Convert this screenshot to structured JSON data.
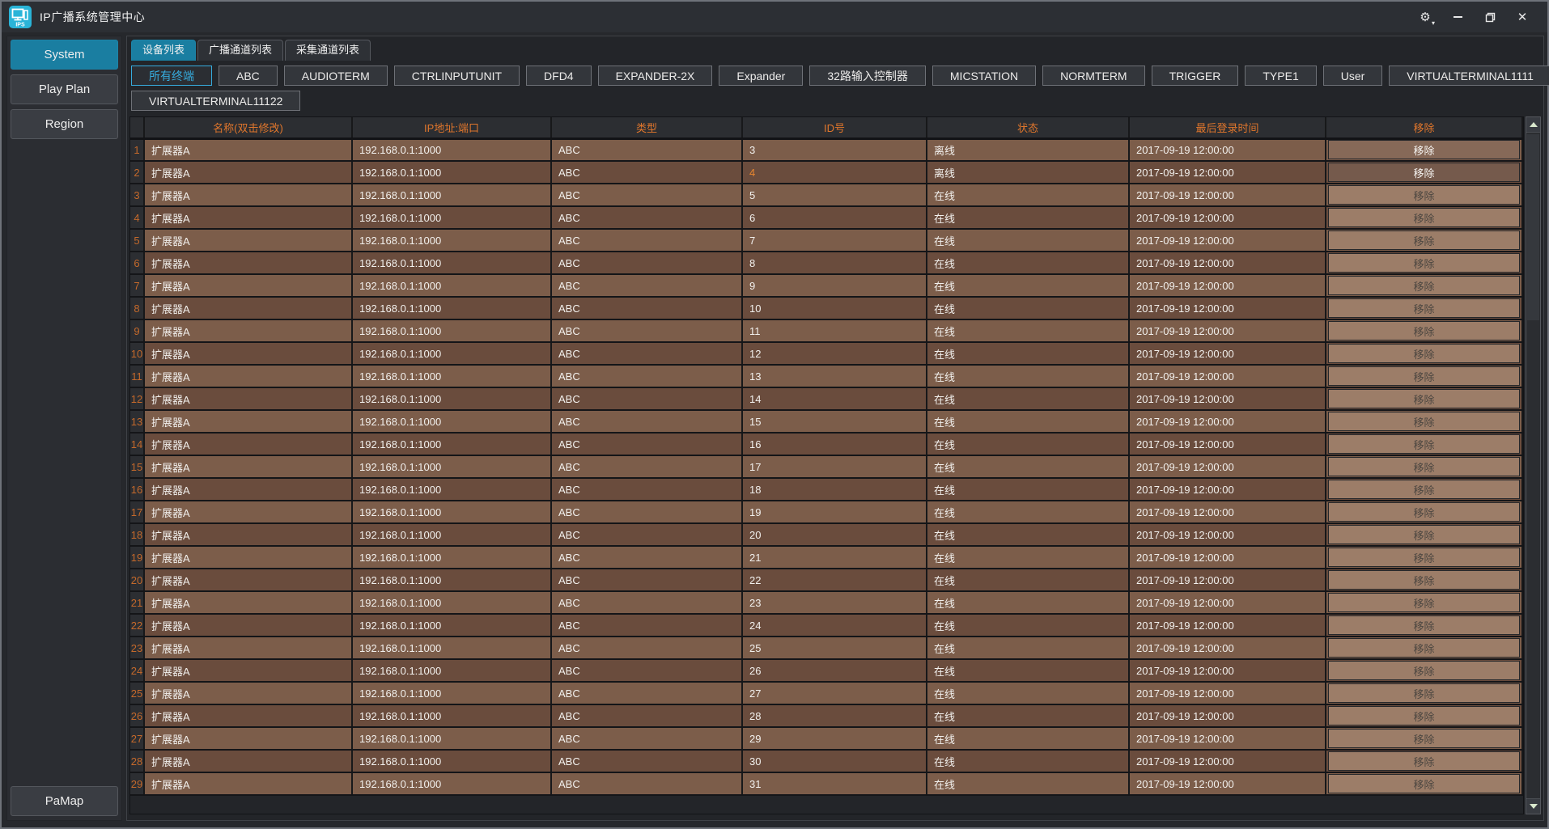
{
  "window": {
    "title": "IP广播系统管理中心",
    "icon_text": "IPS",
    "controls": [
      {
        "name": "settings-gear-icon",
        "glyph": "⚙"
      },
      {
        "name": "minimize-icon",
        "glyph": "–"
      },
      {
        "name": "restore-icon",
        "glyph": "❐"
      },
      {
        "name": "close-icon",
        "glyph": "✕"
      }
    ]
  },
  "sidebar": {
    "items": [
      {
        "label": "System",
        "active": true
      },
      {
        "label": "Play Plan",
        "active": false
      },
      {
        "label": "Region",
        "active": false
      }
    ],
    "bottom_item": {
      "label": "PaMap"
    }
  },
  "tabs": [
    {
      "label": "设备列表",
      "active": true
    },
    {
      "label": "广播通道列表",
      "active": false
    },
    {
      "label": "采集通道列表",
      "active": false
    }
  ],
  "filters": {
    "active": "所有终端",
    "rows": [
      [
        "所有终端",
        "ABC",
        "AUDIOTERM",
        "CTRLINPUTUNIT",
        "DFD4",
        "EXPANDER-2X",
        "Expander",
        "32路输入控制器",
        "MICSTATION",
        "NORMTERM",
        "TRIGGER",
        "TYPE1",
        "User",
        "VIRTUALTERMINAL1111"
      ],
      [
        "VIRTUALTERMINAL11122"
      ]
    ]
  },
  "table": {
    "columns": [
      "名称(双击修改)",
      "IP地址:端口",
      "类型",
      "ID号",
      "状态",
      "最后登录时间",
      "移除"
    ],
    "remove_label": "移除",
    "rows": [
      {
        "num": 1,
        "name": "扩展器A",
        "ip": "192.168.0.1:1000",
        "type": "ABC",
        "id": "3",
        "id_highlighted": false,
        "status": "离线",
        "time": "2017-09-19 12:00:00",
        "removable": true
      },
      {
        "num": 2,
        "name": "扩展器A",
        "ip": "192.168.0.1:1000",
        "type": "ABC",
        "id": "4",
        "id_highlighted": true,
        "status": "离线",
        "time": "2017-09-19 12:00:00",
        "removable": true
      },
      {
        "num": 3,
        "name": "扩展器A",
        "ip": "192.168.0.1:1000",
        "type": "ABC",
        "id": "5",
        "id_highlighted": false,
        "status": "在线",
        "time": "2017-09-19 12:00:00",
        "removable": false
      },
      {
        "num": 4,
        "name": "扩展器A",
        "ip": "192.168.0.1:1000",
        "type": "ABC",
        "id": "6",
        "id_highlighted": false,
        "status": "在线",
        "time": "2017-09-19 12:00:00",
        "removable": false
      },
      {
        "num": 5,
        "name": "扩展器A",
        "ip": "192.168.0.1:1000",
        "type": "ABC",
        "id": "7",
        "id_highlighted": false,
        "status": "在线",
        "time": "2017-09-19 12:00:00",
        "removable": false
      },
      {
        "num": 6,
        "name": "扩展器A",
        "ip": "192.168.0.1:1000",
        "type": "ABC",
        "id": "8",
        "id_highlighted": false,
        "status": "在线",
        "time": "2017-09-19 12:00:00",
        "removable": false
      },
      {
        "num": 7,
        "name": "扩展器A",
        "ip": "192.168.0.1:1000",
        "type": "ABC",
        "id": "9",
        "id_highlighted": false,
        "status": "在线",
        "time": "2017-09-19 12:00:00",
        "removable": false
      },
      {
        "num": 8,
        "name": "扩展器A",
        "ip": "192.168.0.1:1000",
        "type": "ABC",
        "id": "10",
        "id_highlighted": false,
        "status": "在线",
        "time": "2017-09-19 12:00:00",
        "removable": false
      },
      {
        "num": 9,
        "name": "扩展器A",
        "ip": "192.168.0.1:1000",
        "type": "ABC",
        "id": "11",
        "id_highlighted": false,
        "status": "在线",
        "time": "2017-09-19 12:00:00",
        "removable": false
      },
      {
        "num": 10,
        "name": "扩展器A",
        "ip": "192.168.0.1:1000",
        "type": "ABC",
        "id": "12",
        "id_highlighted": false,
        "status": "在线",
        "time": "2017-09-19 12:00:00",
        "removable": false
      },
      {
        "num": 11,
        "name": "扩展器A",
        "ip": "192.168.0.1:1000",
        "type": "ABC",
        "id": "13",
        "id_highlighted": false,
        "status": "在线",
        "time": "2017-09-19 12:00:00",
        "removable": false
      },
      {
        "num": 12,
        "name": "扩展器A",
        "ip": "192.168.0.1:1000",
        "type": "ABC",
        "id": "14",
        "id_highlighted": false,
        "status": "在线",
        "time": "2017-09-19 12:00:00",
        "removable": false
      },
      {
        "num": 13,
        "name": "扩展器A",
        "ip": "192.168.0.1:1000",
        "type": "ABC",
        "id": "15",
        "id_highlighted": false,
        "status": "在线",
        "time": "2017-09-19 12:00:00",
        "removable": false
      },
      {
        "num": 14,
        "name": "扩展器A",
        "ip": "192.168.0.1:1000",
        "type": "ABC",
        "id": "16",
        "id_highlighted": false,
        "status": "在线",
        "time": "2017-09-19 12:00:00",
        "removable": false
      },
      {
        "num": 15,
        "name": "扩展器A",
        "ip": "192.168.0.1:1000",
        "type": "ABC",
        "id": "17",
        "id_highlighted": false,
        "status": "在线",
        "time": "2017-09-19 12:00:00",
        "removable": false
      },
      {
        "num": 16,
        "name": "扩展器A",
        "ip": "192.168.0.1:1000",
        "type": "ABC",
        "id": "18",
        "id_highlighted": false,
        "status": "在线",
        "time": "2017-09-19 12:00:00",
        "removable": false
      },
      {
        "num": 17,
        "name": "扩展器A",
        "ip": "192.168.0.1:1000",
        "type": "ABC",
        "id": "19",
        "id_highlighted": false,
        "status": "在线",
        "time": "2017-09-19 12:00:00",
        "removable": false
      },
      {
        "num": 18,
        "name": "扩展器A",
        "ip": "192.168.0.1:1000",
        "type": "ABC",
        "id": "20",
        "id_highlighted": false,
        "status": "在线",
        "time": "2017-09-19 12:00:00",
        "removable": false
      },
      {
        "num": 19,
        "name": "扩展器A",
        "ip": "192.168.0.1:1000",
        "type": "ABC",
        "id": "21",
        "id_highlighted": false,
        "status": "在线",
        "time": "2017-09-19 12:00:00",
        "removable": false
      },
      {
        "num": 20,
        "name": "扩展器A",
        "ip": "192.168.0.1:1000",
        "type": "ABC",
        "id": "22",
        "id_highlighted": false,
        "status": "在线",
        "time": "2017-09-19 12:00:00",
        "removable": false
      },
      {
        "num": 21,
        "name": "扩展器A",
        "ip": "192.168.0.1:1000",
        "type": "ABC",
        "id": "23",
        "id_highlighted": false,
        "status": "在线",
        "time": "2017-09-19 12:00:00",
        "removable": false
      },
      {
        "num": 22,
        "name": "扩展器A",
        "ip": "192.168.0.1:1000",
        "type": "ABC",
        "id": "24",
        "id_highlighted": false,
        "status": "在线",
        "time": "2017-09-19 12:00:00",
        "removable": false
      },
      {
        "num": 23,
        "name": "扩展器A",
        "ip": "192.168.0.1:1000",
        "type": "ABC",
        "id": "25",
        "id_highlighted": false,
        "status": "在线",
        "time": "2017-09-19 12:00:00",
        "removable": false
      },
      {
        "num": 24,
        "name": "扩展器A",
        "ip": "192.168.0.1:1000",
        "type": "ABC",
        "id": "26",
        "id_highlighted": false,
        "status": "在线",
        "time": "2017-09-19 12:00:00",
        "removable": false
      },
      {
        "num": 25,
        "name": "扩展器A",
        "ip": "192.168.0.1:1000",
        "type": "ABC",
        "id": "27",
        "id_highlighted": false,
        "status": "在线",
        "time": "2017-09-19 12:00:00",
        "removable": false
      },
      {
        "num": 26,
        "name": "扩展器A",
        "ip": "192.168.0.1:1000",
        "type": "ABC",
        "id": "28",
        "id_highlighted": false,
        "status": "在线",
        "time": "2017-09-19 12:00:00",
        "removable": false
      },
      {
        "num": 27,
        "name": "扩展器A",
        "ip": "192.168.0.1:1000",
        "type": "ABC",
        "id": "29",
        "id_highlighted": false,
        "status": "在线",
        "time": "2017-09-19 12:00:00",
        "removable": false
      },
      {
        "num": 28,
        "name": "扩展器A",
        "ip": "192.168.0.1:1000",
        "type": "ABC",
        "id": "30",
        "id_highlighted": false,
        "status": "在线",
        "time": "2017-09-19 12:00:00",
        "removable": false
      },
      {
        "num": 29,
        "name": "扩展器A",
        "ip": "192.168.0.1:1000",
        "type": "ABC",
        "id": "31",
        "id_highlighted": false,
        "status": "在线",
        "time": "2017-09-19 12:00:00",
        "removable": false
      }
    ]
  },
  "colors": {
    "accent_teal": "#1a7ea1",
    "accent_cyan": "#36abdd",
    "header_text_orange": "#e0762c",
    "row_light_brown": "#7c5d4a",
    "row_dark_brown": "#6a4c3d",
    "disabled_button_bg": "#9c7d68",
    "icon_teal": "#2ab4d8"
  }
}
